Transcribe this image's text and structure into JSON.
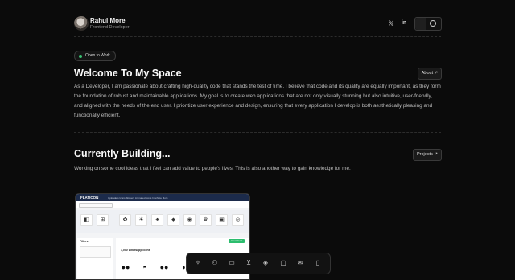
{
  "profile": {
    "name": "Rahul More",
    "role": "Frontend Developer"
  },
  "header_icons": [
    "x-icon",
    "linkedin-icon",
    "theme-toggle-moon-icon"
  ],
  "status_badge": "Open to Work",
  "welcome": {
    "title": "Welcome To My Space",
    "button": "About ↗",
    "body": "As a Developer, I am passionate about crafting high-quality code that stands the test of time. I believe that code and its quality are equally important, as they form the foundation of robust and maintainable applications. My goal is to create web applications that are not only visually stunning but also intuitive, user-friendly, and aligned with the needs of the end user. I prioritize user experience and design, ensuring that every application I develop is both aesthetically pleasing and functionally efficient."
  },
  "building": {
    "title": "Currently Building...",
    "button": "Projects ↗",
    "body": "Working on some cool ideas that I feel can add value to people's lives. This is also another way to gain knowledge for me."
  },
  "preview": {
    "logo": "FLATICON",
    "menu": "Uploaders   Icons   Stickers   Animated icons   Interface   More",
    "section_title": "1,000 Whatsapp icons",
    "download": "Download",
    "sidebar_title": "Filters"
  },
  "dock_icons": [
    "home-icon",
    "user-icon",
    "id-card-icon",
    "cart-icon",
    "layers-icon",
    "monitor-icon",
    "mail-icon",
    "chat-icon"
  ],
  "colors": {
    "background": "#0b0b0b",
    "badge_dot": "#39c172"
  }
}
